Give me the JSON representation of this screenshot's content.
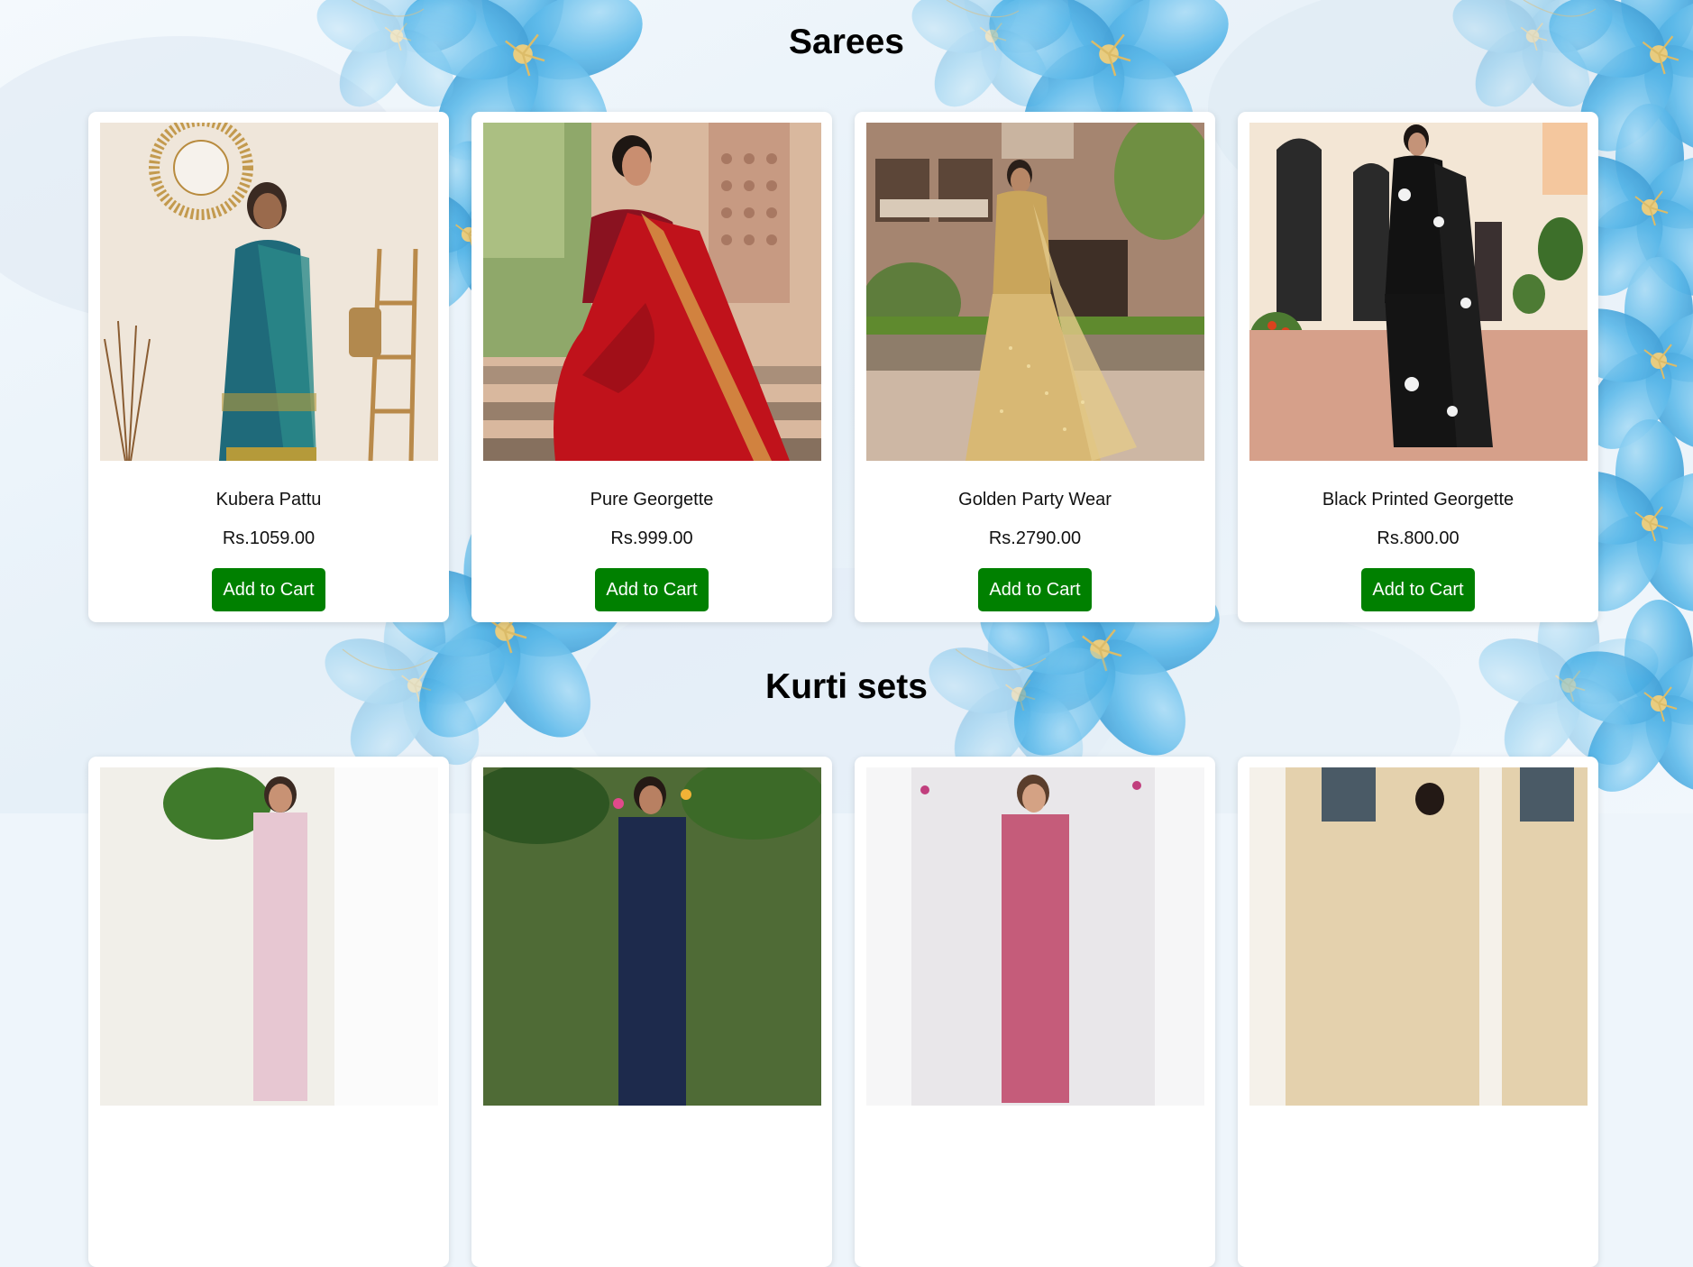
{
  "colors": {
    "button_bg": "#008000",
    "button_text": "#ffffff",
    "card_bg": "#ffffff",
    "flower_blue": "#3aa7e0"
  },
  "sections": [
    {
      "title": "Sarees",
      "products": [
        {
          "name": "Kubera Pattu",
          "price": "Rs.1059.00",
          "button": "Add to Cart",
          "image": "teal-silk-saree-photo"
        },
        {
          "name": "Pure Georgette",
          "price": "Rs.999.00",
          "button": "Add to Cart",
          "image": "red-georgette-saree-photo"
        },
        {
          "name": "Golden Party Wear",
          "price": "Rs.2790.00",
          "button": "Add to Cart",
          "image": "golden-sequin-saree-photo"
        },
        {
          "name": "Black Printed Georgette",
          "price": "Rs.800.00",
          "button": "Add to Cart",
          "image": "black-floral-saree-photo"
        }
      ]
    },
    {
      "title": "Kurti sets",
      "products": [
        {
          "image": "kurti-set-photo-1"
        },
        {
          "image": "kurti-set-photo-2"
        },
        {
          "image": "kurti-set-photo-3"
        },
        {
          "image": "kurti-set-photo-4"
        }
      ]
    }
  ]
}
